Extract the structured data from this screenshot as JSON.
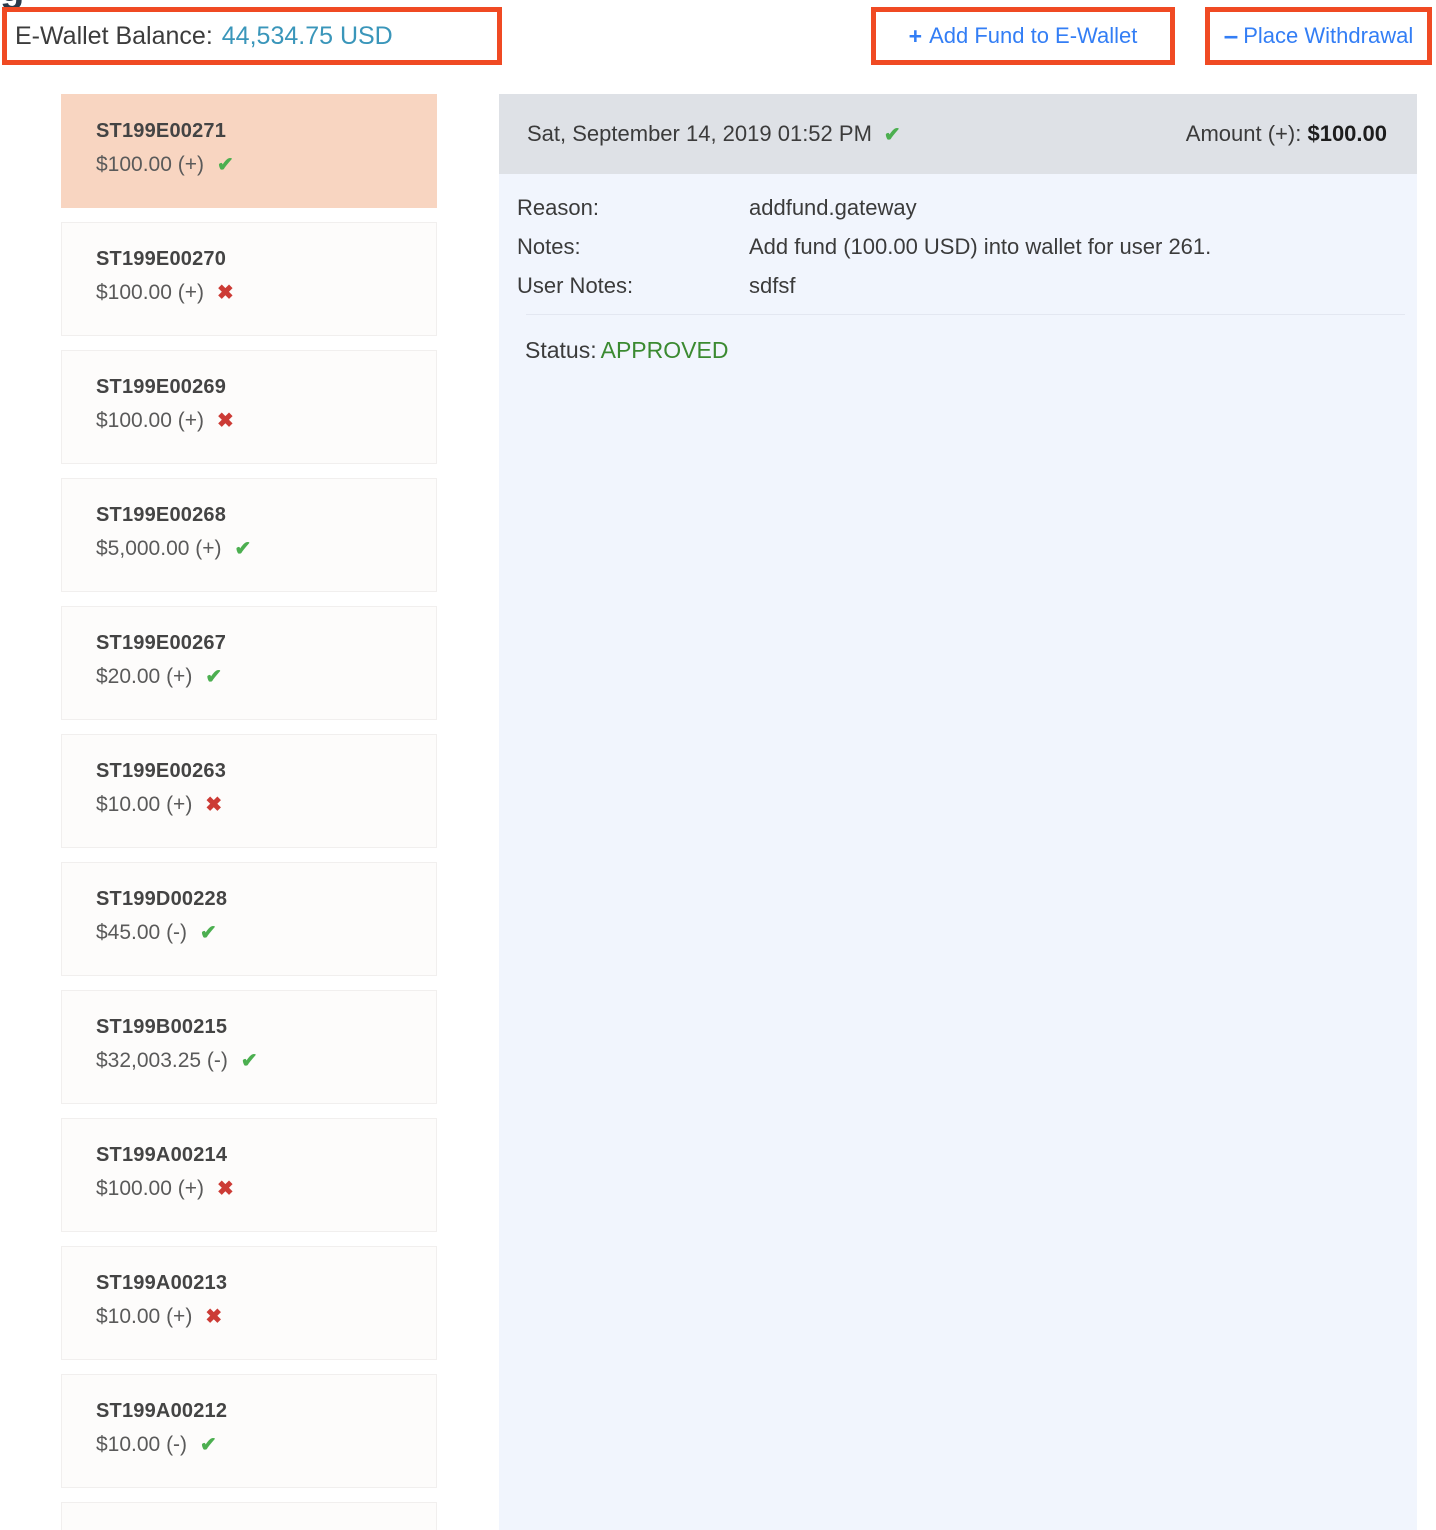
{
  "page": {
    "clipped_heading": "g"
  },
  "topbar": {
    "balance_label": "E-Wallet Balance:",
    "balance_value": "44,534.75 USD",
    "add_fund_sign": "+",
    "add_fund_label": "Add Fund to E-Wallet",
    "withdraw_sign": "–",
    "withdraw_label": "Place Withdrawal"
  },
  "transactions": [
    {
      "id": "ST199E00271",
      "amount": "$100.00 (+)",
      "status_icon": "✔",
      "status": "approved",
      "selected": true
    },
    {
      "id": "ST199E00270",
      "amount": "$100.00 (+)",
      "status_icon": "✖",
      "status": "rejected",
      "selected": false
    },
    {
      "id": "ST199E00269",
      "amount": "$100.00 (+)",
      "status_icon": "✖",
      "status": "rejected",
      "selected": false
    },
    {
      "id": "ST199E00268",
      "amount": "$5,000.00 (+)",
      "status_icon": "✔",
      "status": "approved",
      "selected": false
    },
    {
      "id": "ST199E00267",
      "amount": "$20.00 (+)",
      "status_icon": "✔",
      "status": "approved",
      "selected": false
    },
    {
      "id": "ST199E00263",
      "amount": "$10.00 (+)",
      "status_icon": "✖",
      "status": "rejected",
      "selected": false
    },
    {
      "id": "ST199D00228",
      "amount": "$45.00 (-)",
      "status_icon": "✔",
      "status": "approved",
      "selected": false
    },
    {
      "id": "ST199B00215",
      "amount": "$32,003.25 (-)",
      "status_icon": "✔",
      "status": "approved",
      "selected": false
    },
    {
      "id": "ST199A00214",
      "amount": "$100.00 (+)",
      "status_icon": "✖",
      "status": "rejected",
      "selected": false
    },
    {
      "id": "ST199A00213",
      "amount": "$10.00 (+)",
      "status_icon": "✖",
      "status": "rejected",
      "selected": false
    },
    {
      "id": "ST199A00212",
      "amount": "$10.00 (-)",
      "status_icon": "✔",
      "status": "approved",
      "selected": false
    }
  ],
  "detail": {
    "date": "Sat, September 14, 2019 01:52 PM",
    "date_status_icon": "✔",
    "amount_label": "Amount (+):",
    "amount_value": "$100.00",
    "reason_label": "Reason:",
    "reason_value": "addfund.gateway",
    "notes_label": "Notes:",
    "notes_value": "Add fund (100.00 USD) into wallet for user 261.",
    "user_notes_label": "User Notes:",
    "user_notes_value": "sdfsf",
    "status_label": "Status:",
    "status_value": "APPROVED"
  },
  "colors": {
    "highlight_box_border": "#f04a23",
    "balance_value": "#3a96ba",
    "action_link": "#337ef5",
    "selected_item_bg": "#f8d5c1",
    "approved": "#4caf50",
    "rejected": "#cc3b35",
    "status_approved_text": "#3b8a31",
    "detail_head_bg": "#dee1e6",
    "detail_body_bg": "#f1f5fd"
  }
}
